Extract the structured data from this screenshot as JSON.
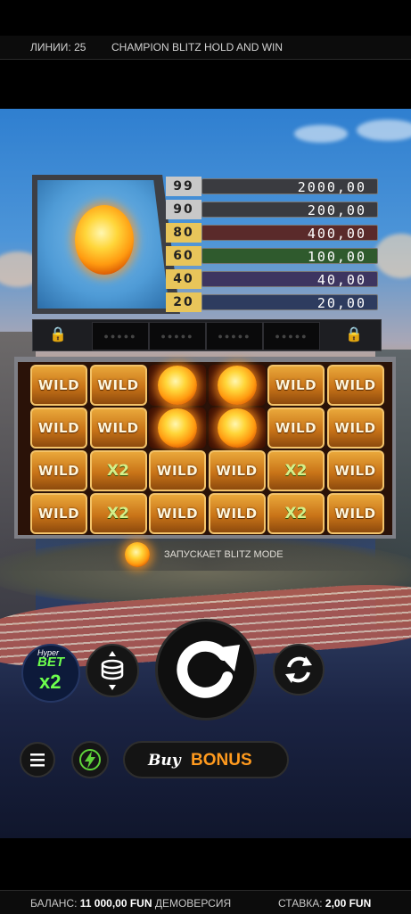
{
  "topbar": {
    "lines": "ЛИНИИ: 25",
    "game_title": "CHAMPION BLITZ HOLD AND WIN"
  },
  "paytable": [
    {
      "count": "99",
      "payout": "2000,00",
      "color": "#3a3b40"
    },
    {
      "count": "90",
      "payout": "200,00",
      "color": "#3a3b40"
    },
    {
      "count": "80",
      "payout": "400,00",
      "color": "#5a2a2a"
    },
    {
      "count": "60",
      "payout": "100,00",
      "color": "#2f5a2d"
    },
    {
      "count": "40",
      "payout": "40,00",
      "color": "#3d3560"
    },
    {
      "count": "20",
      "payout": "20,00",
      "color": "#2e3c5f"
    }
  ],
  "reels": [
    [
      "WILD",
      "WILD",
      "ball",
      "ball",
      "WILD",
      "WILD"
    ],
    [
      "WILD",
      "WILD",
      "ball",
      "ball",
      "WILD",
      "WILD"
    ],
    [
      "WILD",
      "X2",
      "WILD",
      "WILD",
      "X2",
      "WILD"
    ],
    [
      "WILD",
      "X2",
      "WILD",
      "WILD",
      "X2",
      "WILD"
    ]
  ],
  "blitz_text": "ЗАПУСКАЕТ BLITZ MODE",
  "controls": {
    "hyper_bet_1": "Hyper",
    "hyper_bet_2": "BET",
    "hyper_bet_3": "x2",
    "buy_1": "Buy",
    "buy_2": "BONUS"
  },
  "bottombar": {
    "balance_label": "БАЛАНС:",
    "balance_value": "11 000,00 FUN",
    "mode": "ДЕМОВЕРСИЯ",
    "bet_label": "СТАВКА:",
    "bet_value": "2,00 FUN"
  }
}
